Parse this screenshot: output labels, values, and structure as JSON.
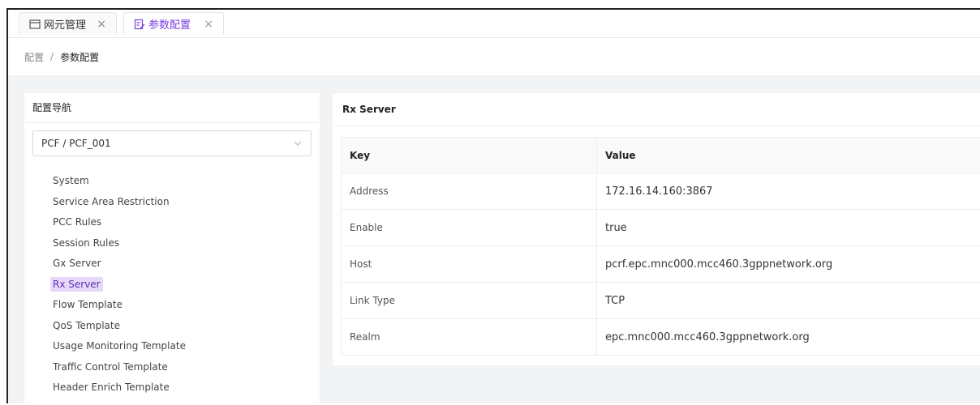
{
  "tabs": [
    {
      "label": "网元管理",
      "close": "×"
    },
    {
      "label": "参数配置",
      "close": "×"
    }
  ],
  "breadcrumb": {
    "root": "配置",
    "separator": "/",
    "current": "参数配置"
  },
  "left_panel": {
    "title": "配置导航",
    "select_value": "PCF / PCF_001",
    "nav_items": [
      "System",
      "Service Area Restriction",
      "PCC Rules",
      "Session Rules",
      "Gx Server",
      "Rx Server",
      "Flow Template",
      "QoS Template",
      "Usage Monitoring Template",
      "Traffic Control Template",
      "Header Enrich Template"
    ],
    "active_item": "Rx Server"
  },
  "right_panel": {
    "title": "Rx Server",
    "columns": [
      "Key",
      "Value"
    ],
    "rows": [
      {
        "key": "Address",
        "value": "172.16.14.160:3867"
      },
      {
        "key": "Enable",
        "value": "true"
      },
      {
        "key": "Host",
        "value": "pcrf.epc.mnc000.mcc460.3gppnetwork.org"
      },
      {
        "key": "Link Type",
        "value": "TCP"
      },
      {
        "key": "Realm",
        "value": "epc.mnc000.mcc460.3gppnetwork.org"
      }
    ]
  },
  "colors": {
    "accent": "#7b3fe4",
    "active_bg": "#e7d8fb",
    "page_bg": "#f2f3f5"
  }
}
